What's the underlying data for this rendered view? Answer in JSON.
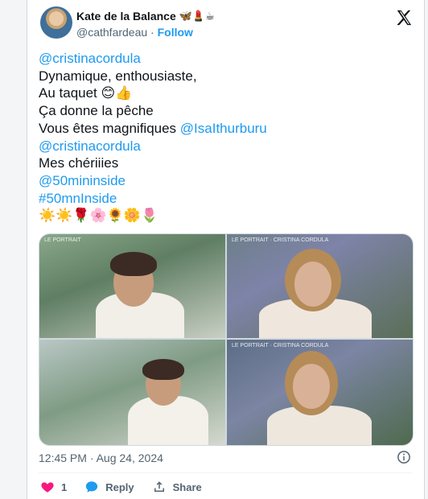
{
  "author": {
    "name": "Kate de la Balance",
    "name_emojis": "🦋💄☕",
    "handle": "@cathfardeau",
    "separator": "·",
    "follow_label": "Follow"
  },
  "post": {
    "lines": [
      {
        "mention": "@cristinacordula"
      },
      {
        "text": "Dynamique, enthousiaste,"
      },
      {
        "text": "Au taquet ",
        "emojis": "😊👍"
      },
      {
        "text": "Ça donne la pêche"
      },
      {
        "text": "Vous êtes magnifiques ",
        "mention": "@IsaIthurburu"
      },
      {
        "mention": "@cristinacordula"
      },
      {
        "text": "Mes chériiies"
      },
      {
        "mention": "@50mininside"
      },
      {
        "mention": "#50mnInside"
      },
      {
        "emojis": "☀️☀️🌹🌸🌻🌼🌷"
      }
    ],
    "media_captions": [
      "LE PORTRAIT",
      "LE PORTRAIT · CRISTINA CORDULA",
      "",
      "LE PORTRAIT · CRISTINA CORDULA"
    ],
    "timestamp": "12:45 PM · Aug 24, 2024"
  },
  "actions": {
    "like_count": "1",
    "reply_label": "Reply",
    "share_label": "Share"
  },
  "colors": {
    "link": "#1d9bf0",
    "like": "#f91880",
    "text": "#0f1419",
    "muted": "#536471"
  }
}
